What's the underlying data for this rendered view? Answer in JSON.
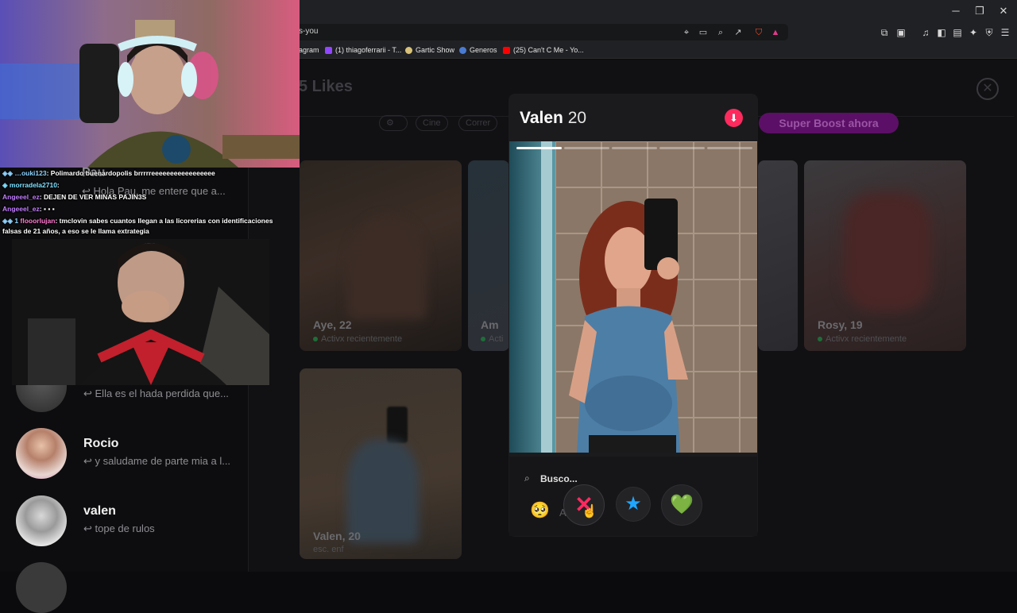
{
  "browser": {
    "url_fragment": "s-you",
    "bookmarks": [
      {
        "label": "agram",
        "color": "#c13584"
      },
      {
        "label": "(1) thiagoferrarii - T...",
        "color": "#9146ff"
      },
      {
        "label": "Gartic Show",
        "color": "#d8c27a"
      },
      {
        "label": "Generos",
        "color": "#4a7bd0"
      },
      {
        "label": "(25) Can't C Me - Yo...",
        "color": "#ff0000"
      }
    ],
    "window_controls": {
      "minimize": "─",
      "restore": "❐",
      "close": "✕"
    }
  },
  "page": {
    "likes_title": "5 Likes",
    "filters": [
      "Cine",
      "Correr"
    ],
    "super_boost": "Super Boost ahora",
    "close_icon": "close-icon"
  },
  "matches": [
    {
      "name": "Pau",
      "message": "Hola Pau, me entere que a..."
    },
    {
      "name": "",
      "message": "Ella es el hada perdida que..."
    },
    {
      "name": "Rocio",
      "message": "y saludame de parte mia a l..."
    },
    {
      "name": "valen",
      "message": "tope de rulos"
    }
  ],
  "cards": [
    {
      "name": "Aye, 22",
      "status": "Activx recientemente"
    },
    {
      "name": "Am",
      "status": "Acti"
    },
    {
      "name": "Rosy, 19",
      "status": "Activx recientemente"
    },
    {
      "name": "Valen, 20",
      "status": "esc. enf"
    }
  ],
  "modal": {
    "name": "Valen",
    "age": "20",
    "busco_label": "Busco...",
    "busco_value_fragment": "A       lo    go c",
    "busco_emoji": "🥺",
    "actions": {
      "nope": "✕",
      "super_like": "★",
      "like": "💚"
    }
  },
  "chat": [
    {
      "user": "…ouki123",
      "user_color": "#8fd3ff",
      "text": ": Polimardo buenardopolis brrrrreeeeeeeeeeeeeeeee"
    },
    {
      "user": "morradela2710",
      "user_color": "#7ee0ff",
      "text": ":"
    },
    {
      "user": "Angeeel_ez",
      "user_color": "#c37dff",
      "text": ": DEJEN DE VER MINAS PAJIN3S"
    },
    {
      "user": "Angeeel_ez",
      "user_color": "#c37dff",
      "text": ":"
    },
    {
      "user": "flooorlujan",
      "user_color": "#ff7ad0",
      "text": ": tmclovin sabes cuantos llegan a las licorerias con identificaciones"
    },
    {
      "user": "",
      "user_color": "#ffffff",
      "text": "falsas de 21 años, a eso se le llama extrategia"
    }
  ],
  "colors": {
    "accent_pink": "#fd2a5e",
    "boost_purple": "#5c0f66",
    "like_green": "#6ee04a",
    "star_blue": "#1fa7ff"
  }
}
